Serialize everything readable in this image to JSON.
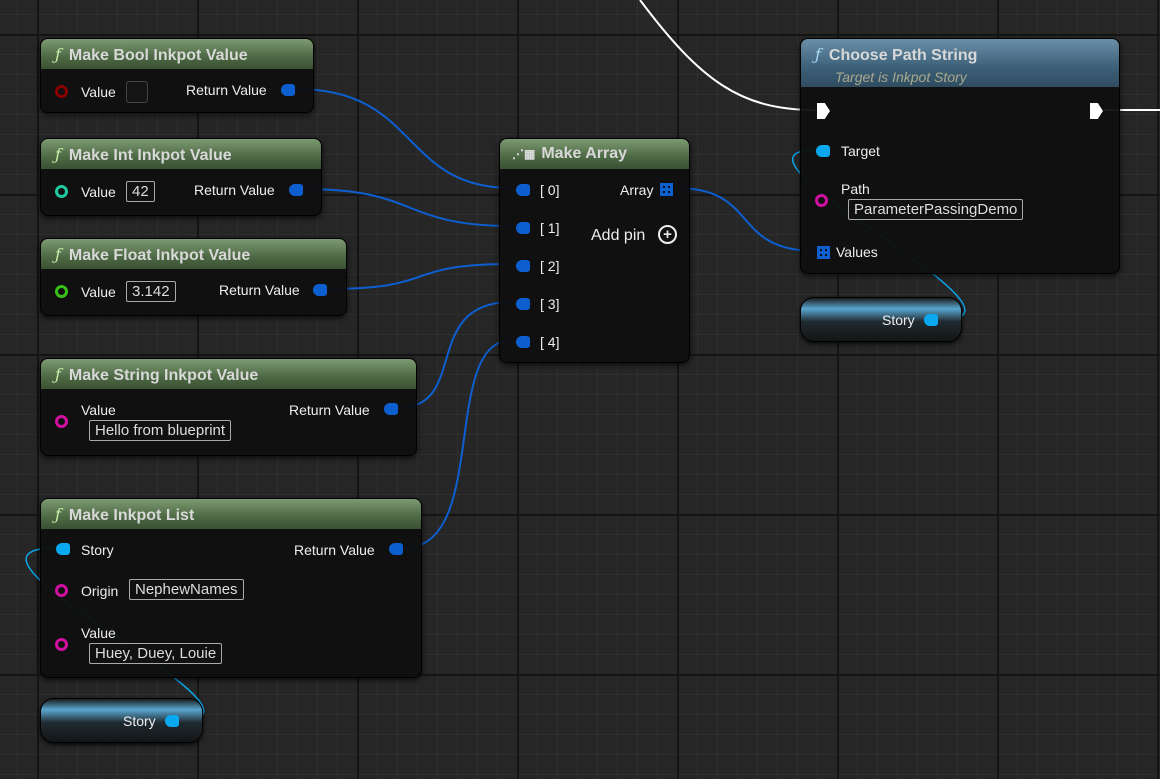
{
  "colors": {
    "object_pin": "#0d5fd0",
    "story_pin": "#0aa8f0",
    "string_pin": "#d010a0",
    "bool_pin": "#8a0000",
    "int_pin": "#1fc8a0",
    "float_pin": "#38c018",
    "exec": "#ffffff"
  },
  "nodes": {
    "bool": {
      "title": "Make Bool Inkpot Value",
      "in_label": "Value",
      "out_label": "Return Value"
    },
    "int": {
      "title": "Make Int Inkpot Value",
      "in_label": "Value",
      "in_value": "42",
      "out_label": "Return Value"
    },
    "float": {
      "title": "Make Float Inkpot Value",
      "in_label": "Value",
      "in_value": "3.142",
      "out_label": "Return Value"
    },
    "string": {
      "title": "Make String Inkpot Value",
      "in_label": "Value",
      "in_value": "Hello from blueprint",
      "out_label": "Return Value"
    },
    "list": {
      "title": "Make Inkpot List",
      "story_label": "Story",
      "origin_label": "Origin",
      "origin_value": "NephewNames",
      "value_label": "Value",
      "value_value": "Huey, Duey, Louie",
      "out_label": "Return Value"
    },
    "make_array": {
      "title": "Make Array",
      "inputs": [
        "[ 0]",
        "[ 1]",
        "[ 2]",
        "[ 3]",
        "[ 4]"
      ],
      "out_label": "Array",
      "add_pin": "Add pin"
    },
    "choose_path": {
      "title": "Choose Path String",
      "subtitle": "Target is Inkpot Story",
      "target_label": "Target",
      "path_label": "Path",
      "path_value": "ParameterPassingDemo",
      "values_label": "Values"
    },
    "story_var_1": {
      "label": "Story"
    },
    "story_var_2": {
      "label": "Story"
    }
  }
}
